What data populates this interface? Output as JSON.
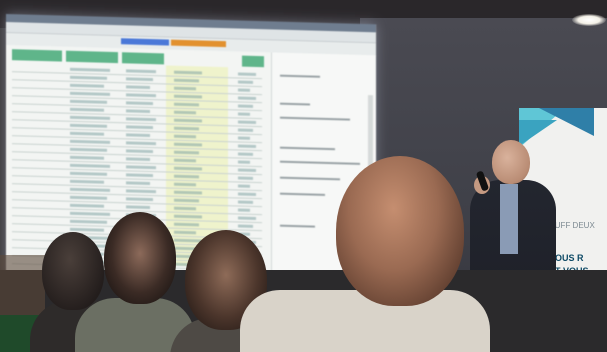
{
  "banner": {
    "line1": "RUFF DEUX",
    "line2": "VOUS R",
    "line3": "ET VOUS"
  },
  "colors": {
    "screen_header_green": "#5fb58a",
    "ribbon_blue": "#4a78d8",
    "ribbon_orange": "#e2912f",
    "banner_teal": "#3aa3c0",
    "banner_text": "#0e4a66"
  }
}
